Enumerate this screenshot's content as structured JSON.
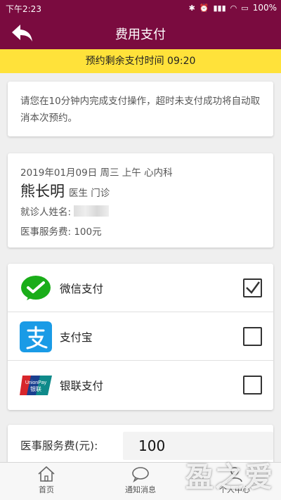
{
  "status_bar": {
    "time": "下午2:23",
    "battery": "100%"
  },
  "app_bar": {
    "title": "费用支付"
  },
  "countdown": {
    "text": "预约剩余支付时间 09:20"
  },
  "notice": {
    "text": "请您在10分钟内完成支付操作，超时未支付成功将自动取消本次预约。"
  },
  "booking": {
    "date_line": "2019年01月09日 周三 上午 心内科",
    "doctor": "熊长明",
    "doctor_role": "医生 门诊",
    "patient_label": "就诊人姓名:",
    "fee_line": "医事服务费: 100元"
  },
  "payment": {
    "options": [
      {
        "label": "微信支付",
        "checked": true
      },
      {
        "label": "支付宝",
        "checked": false
      },
      {
        "label": "银联支付",
        "checked": false
      }
    ]
  },
  "fee_field": {
    "label": "医事服务费(元):",
    "value": "100"
  },
  "tabs": [
    {
      "label": "首页"
    },
    {
      "label": "通知消息"
    },
    {
      "label": "个人中心"
    }
  ],
  "watermark": "盈之爱",
  "colors": {
    "primary": "#7a0b3f",
    "banner": "#ffe23a",
    "wechat": "#1aad19",
    "alipay": "#1a9be6",
    "unionpay": "#d7262c"
  }
}
